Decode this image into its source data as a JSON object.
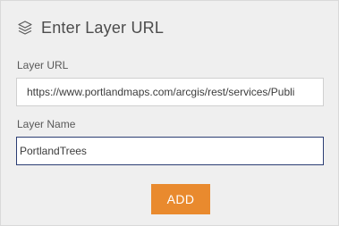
{
  "header": {
    "title": "Enter Layer URL",
    "icon": "layers-icon"
  },
  "layer_url": {
    "label": "Layer URL",
    "value": "https://www.portlandmaps.com/arcgis/rest/services/Publi"
  },
  "layer_name": {
    "label": "Layer Name",
    "value": "PortlandTrees"
  },
  "actions": {
    "add_label": "ADD"
  },
  "colors": {
    "accent": "#e98a2e",
    "panel_bg": "#efefef",
    "focus_border": "#2b3d73"
  }
}
